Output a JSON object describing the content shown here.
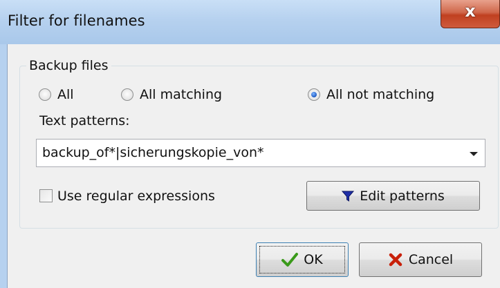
{
  "window": {
    "title": "Filter for filenames",
    "close_label": "x"
  },
  "group": {
    "title": "Backup files",
    "radios": [
      {
        "label": "All",
        "checked": false
      },
      {
        "label": "All matching",
        "checked": false
      },
      {
        "label": "All not matching",
        "checked": true
      }
    ],
    "patterns_label": "Text patterns:",
    "patterns_value": "backup_of*|sicherungskopie_von*",
    "regex_label": "Use regular expressions",
    "regex_checked": false,
    "edit_patterns_label": "Edit patterns"
  },
  "buttons": {
    "ok": "OK",
    "cancel": "Cancel"
  },
  "icons": {
    "close": "close-icon",
    "filter": "funnel-icon",
    "ok": "checkmark-icon",
    "cancel": "cross-icon"
  },
  "colors": {
    "titlebar": "#b6d1ef",
    "close_red": "#c04020",
    "funnel_blue": "#1f2fa8",
    "check_green": "#3a9a1a",
    "cross_red": "#c8200a"
  }
}
